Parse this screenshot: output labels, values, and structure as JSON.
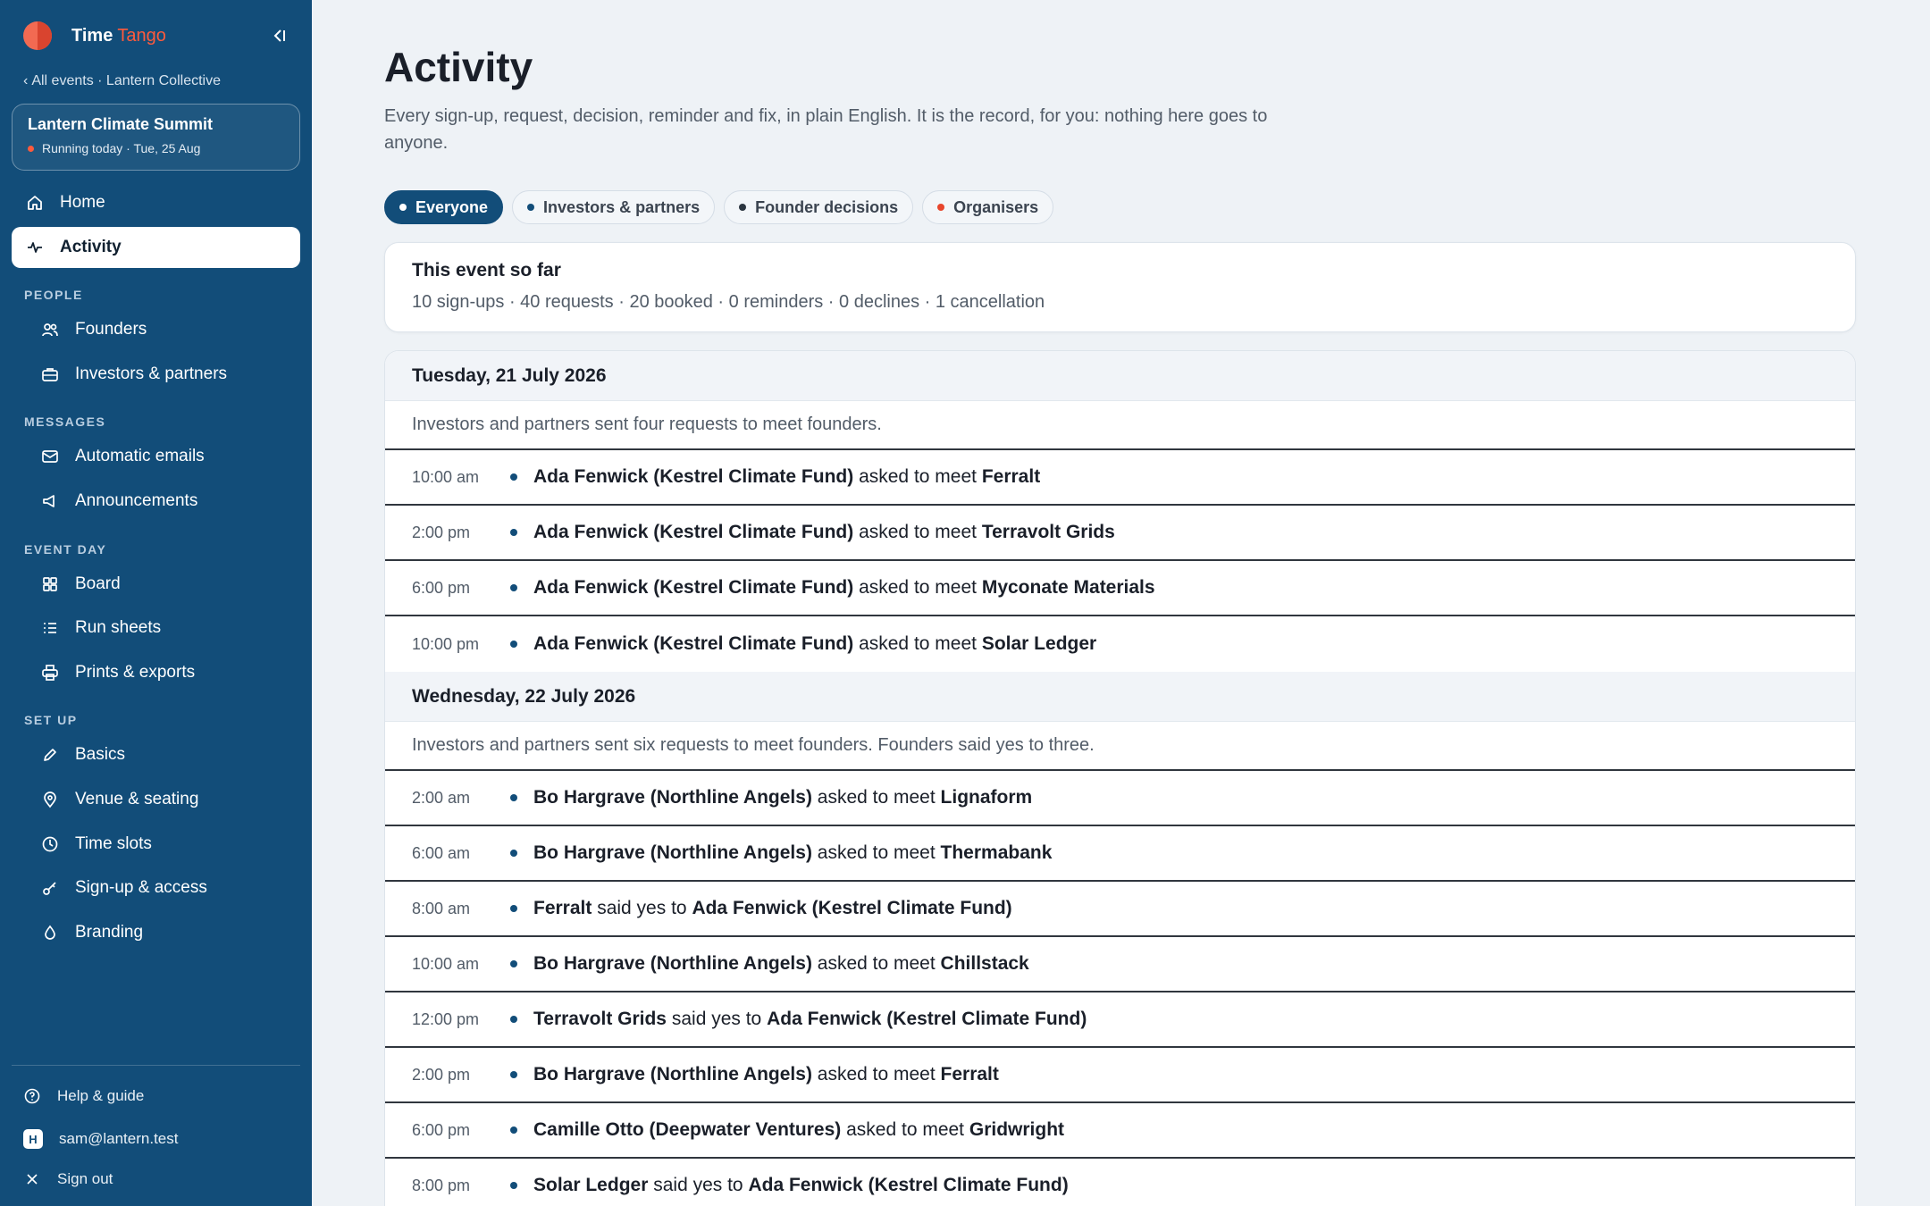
{
  "brand": {
    "name": "Time",
    "accent": "Tango"
  },
  "back_link": {
    "chevron": "‹",
    "label": "All events · Lantern Collective"
  },
  "event": {
    "title": "Lantern Climate Summit",
    "status": "Running today · Tue, 25 Aug"
  },
  "nav": {
    "home": "Home",
    "activity": "Activity",
    "people_label": "PEOPLE",
    "founders": "Founders",
    "investors": "Investors & partners",
    "messages_label": "MESSAGES",
    "automatic_emails": "Automatic emails",
    "announcements": "Announcements",
    "event_day_label": "EVENT DAY",
    "board": "Board",
    "run_sheets": "Run sheets",
    "prints": "Prints & exports",
    "setup_label": "SET UP",
    "basics": "Basics",
    "venue": "Venue & seating",
    "time_slots": "Time slots",
    "signup": "Sign-up & access",
    "branding": "Branding"
  },
  "footer": {
    "help": "Help & guide",
    "avatar_initial": "H",
    "user": "sam@lantern.test",
    "signout": "Sign out"
  },
  "page": {
    "title": "Activity",
    "description": "Every sign-up, request, decision, reminder and fix, in plain English. It is the record, for you: nothing here goes to anyone."
  },
  "filters": [
    {
      "label": "Everyone",
      "dot": "#ffffff",
      "active": true
    },
    {
      "label": "Investors & partners",
      "dot": "#124d79",
      "active": false
    },
    {
      "label": "Founder decisions",
      "dot": "#2b3540",
      "active": false
    },
    {
      "label": "Organisers",
      "dot": "#e8452c",
      "active": false
    }
  ],
  "summary": {
    "title": "This event so far",
    "stats": "10 sign-ups · 40 requests · 20 booked · 0 reminders · 0 declines · 1 cancellation"
  },
  "days": [
    {
      "date": "Tuesday, 21 July 2026",
      "summary": "Investors and partners sent four requests to meet founders.",
      "events": [
        {
          "time": "10:00 am",
          "a": "Ada Fenwick (Kestrel Climate Fund)",
          "verb": "asked to meet",
          "b": "Ferralt"
        },
        {
          "time": "2:00 pm",
          "a": "Ada Fenwick (Kestrel Climate Fund)",
          "verb": "asked to meet",
          "b": "Terravolt Grids"
        },
        {
          "time": "6:00 pm",
          "a": "Ada Fenwick (Kestrel Climate Fund)",
          "verb": "asked to meet",
          "b": "Myconate Materials"
        },
        {
          "time": "10:00 pm",
          "a": "Ada Fenwick (Kestrel Climate Fund)",
          "verb": "asked to meet",
          "b": "Solar Ledger"
        }
      ]
    },
    {
      "date": "Wednesday, 22 July 2026",
      "summary": "Investors and partners sent six requests to meet founders. Founders said yes to three.",
      "events": [
        {
          "time": "2:00 am",
          "a": "Bo Hargrave (Northline Angels)",
          "verb": "asked to meet",
          "b": "Lignaform"
        },
        {
          "time": "6:00 am",
          "a": "Bo Hargrave (Northline Angels)",
          "verb": "asked to meet",
          "b": "Thermabank"
        },
        {
          "time": "8:00 am",
          "a": "Ferralt",
          "verb": "said yes to",
          "b": "Ada Fenwick (Kestrel Climate Fund)"
        },
        {
          "time": "10:00 am",
          "a": "Bo Hargrave (Northline Angels)",
          "verb": "asked to meet",
          "b": "Chillstack"
        },
        {
          "time": "12:00 pm",
          "a": "Terravolt Grids",
          "verb": "said yes to",
          "b": "Ada Fenwick (Kestrel Climate Fund)"
        },
        {
          "time": "2:00 pm",
          "a": "Bo Hargrave (Northline Angels)",
          "verb": "asked to meet",
          "b": "Ferralt"
        },
        {
          "time": "6:00 pm",
          "a": "Camille Otto (Deepwater Ventures)",
          "verb": "asked to meet",
          "b": "Gridwright"
        },
        {
          "time": "8:00 pm",
          "a": "Solar Ledger",
          "verb": "said yes to",
          "b": "Ada Fenwick (Kestrel Climate Fund)"
        }
      ]
    }
  ]
}
